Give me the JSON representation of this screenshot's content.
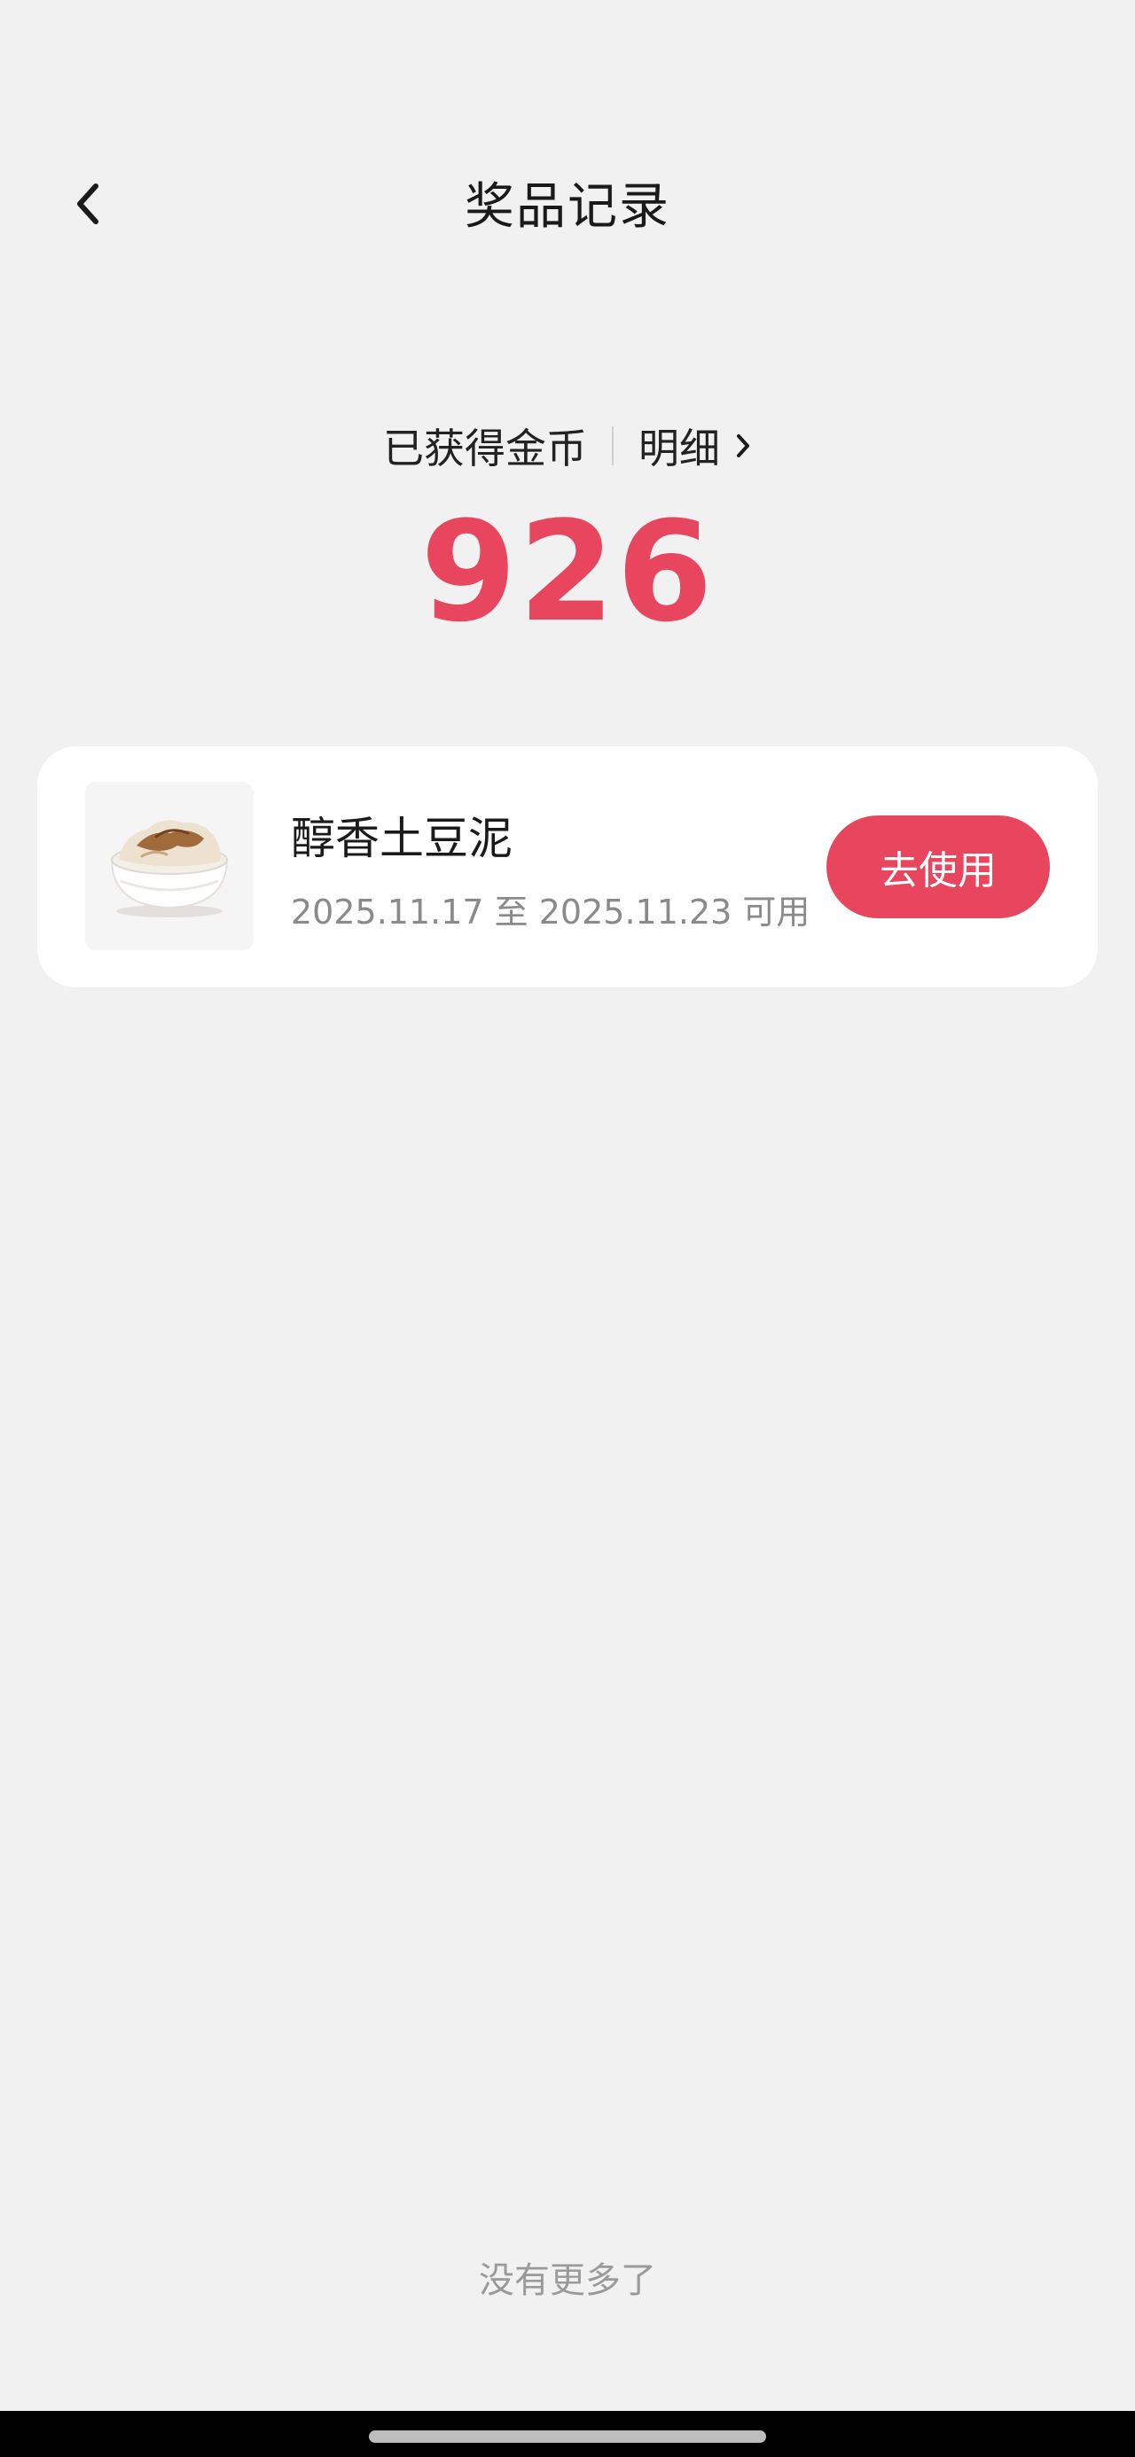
{
  "header": {
    "title": "奖品记录",
    "back_icon": "chevron-left-icon"
  },
  "coins": {
    "label": "已获得金币",
    "detail_label": "明细",
    "detail_icon": "chevron-right-icon",
    "value": "926",
    "accent_color": "#e8465f"
  },
  "prizes": [
    {
      "name": "醇香土豆泥",
      "validity": "2025.11.17 至 2025.11.23 可用",
      "image": "mashed-potato-bowl",
      "action_label": "去使用"
    }
  ],
  "footer": {
    "end_text": "没有更多了"
  },
  "colors": {
    "background": "#f2f1f2",
    "card": "#ffffff",
    "accent": "#e8465f"
  }
}
